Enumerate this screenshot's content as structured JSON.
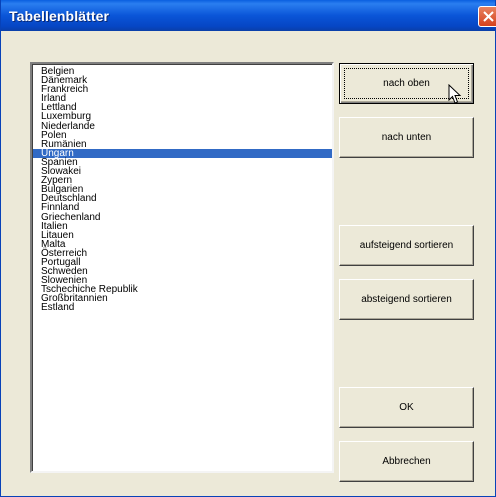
{
  "window": {
    "title": "Tabellenblätter"
  },
  "list": {
    "items": [
      "Belgien",
      "Dänemark",
      "Frankreich",
      "Irland",
      "Lettland",
      "Luxemburg",
      "Niederlande",
      "Polen",
      "Rumänien",
      "Ungarn",
      "Spanien",
      "Slowakei",
      "Zypern",
      "Bulgarien",
      "Deutschland",
      "Finnland",
      "Griechenland",
      "Italien",
      "Litauen",
      "Malta",
      "Österreich",
      "Portugall",
      "Schweden",
      "Slowenien",
      "Tschechiche Republik",
      "Großbritannien",
      "Estland"
    ],
    "selected_index": 9,
    "selected_color": "#316ac5"
  },
  "buttons": {
    "up": "nach oben",
    "down": "nach unten",
    "sort_asc": "aufsteigend sortieren",
    "sort_desc": "absteigend sortieren",
    "ok": "OK",
    "cancel": "Abbrechen"
  },
  "icons": {
    "close": "close-icon",
    "cursor": "mouse-cursor-icon"
  }
}
